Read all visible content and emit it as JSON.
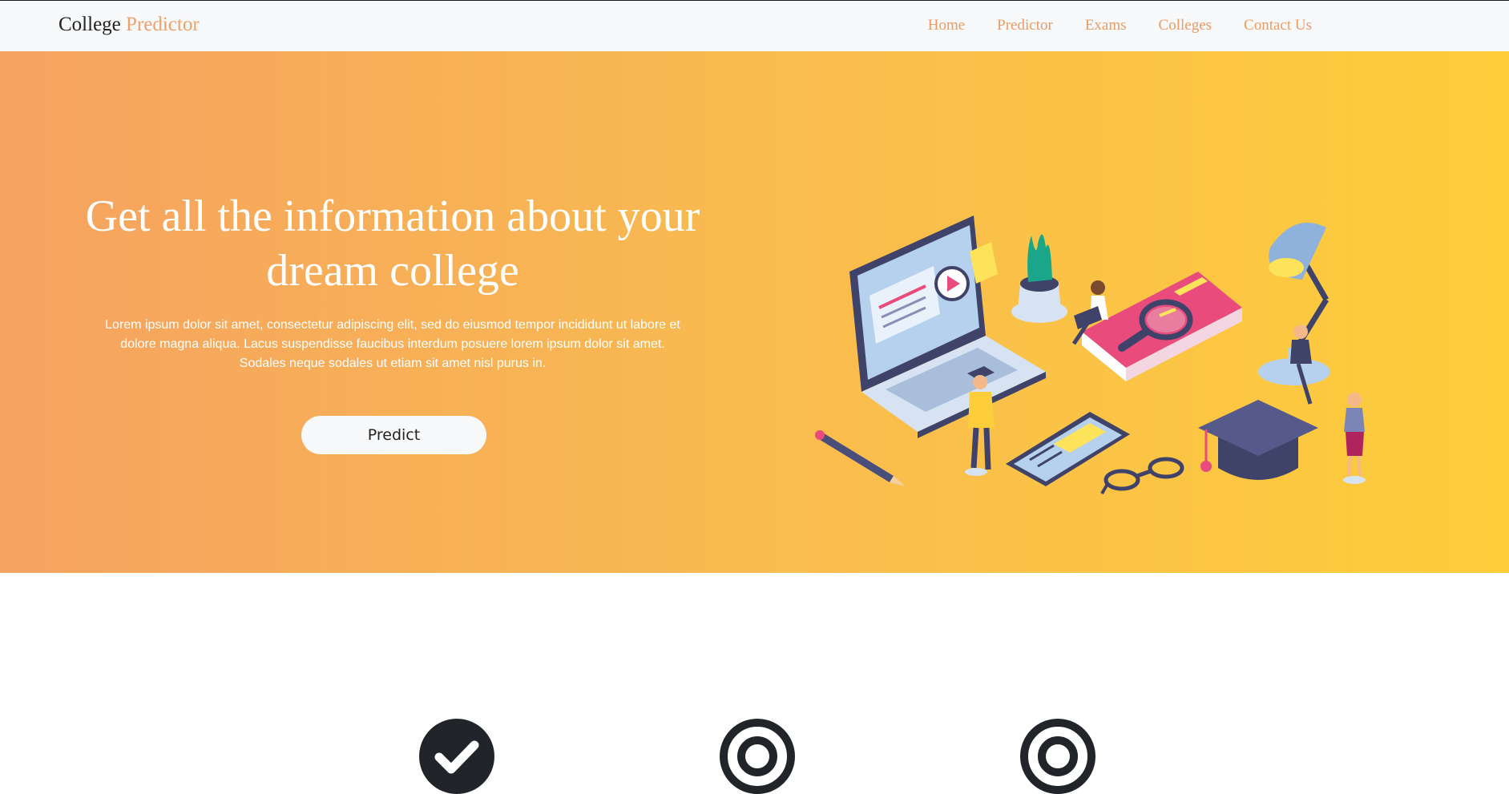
{
  "brand": {
    "name_primary": "College",
    "name_accent": "Predictor"
  },
  "nav": {
    "items": [
      {
        "label": "Home"
      },
      {
        "label": "Predictor"
      },
      {
        "label": "Exams"
      },
      {
        "label": "Colleges"
      },
      {
        "label": "Contact Us"
      }
    ]
  },
  "hero": {
    "title": "Get all the information about your dream college",
    "description": "Lorem ipsum dolor sit amet, consectetur adipiscing elit, sed do eiusmod tempor incididunt ut labore et dolore magna aliqua. Lacus suspendisse faucibus interdum posuere lorem ipsum dolor sit amet. Sodales neque sodales ut etiam sit amet nisl purus in.",
    "button_label": "Predict",
    "illustration": "isometric-education-illustration"
  },
  "features": {
    "icons": [
      {
        "icon": "check-circle-icon"
      },
      {
        "icon": "target-icon"
      },
      {
        "icon": "target-icon"
      }
    ]
  },
  "colors": {
    "brand_accent": "#f0a06a",
    "nav_link": "#ef9a63",
    "hero_gradient_start": "#f6a260",
    "hero_gradient_end": "#fdcd3a",
    "navbar_bg": "#f8f9fa",
    "icon_dark": "#212529"
  }
}
